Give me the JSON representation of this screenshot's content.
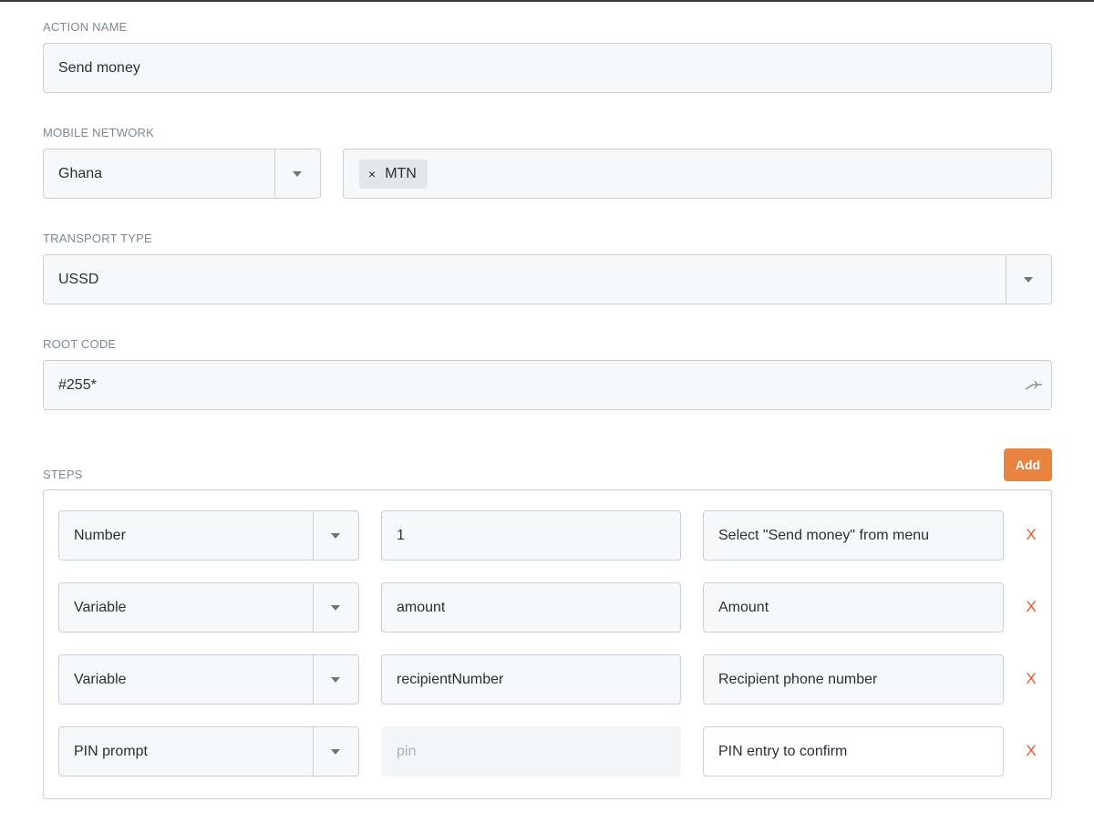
{
  "action_name": {
    "label": "ACTION NAME",
    "value": "Send money"
  },
  "mobile_network": {
    "label": "MOBILE NETWORK",
    "country": "Ghana",
    "tags": [
      {
        "remove": "×",
        "text": "MTN"
      }
    ]
  },
  "transport_type": {
    "label": "TRANSPORT TYPE",
    "value": "USSD"
  },
  "root_code": {
    "label": "ROOT CODE",
    "value": "#255*"
  },
  "steps": {
    "label": "STEPS",
    "add_label": "Add",
    "remove_label": "X",
    "rows": [
      {
        "type": "Number",
        "value": "1",
        "placeholder": "",
        "description": "Select \"Send money\" from menu"
      },
      {
        "type": "Variable",
        "value": "amount",
        "placeholder": "",
        "description": "Amount"
      },
      {
        "type": "Variable",
        "value": "recipientNumber",
        "placeholder": "",
        "description": "Recipient phone number"
      },
      {
        "type": "PIN prompt",
        "value": "",
        "placeholder": "pin",
        "description": "PIN entry to confirm"
      }
    ]
  },
  "colors": {
    "accent": "#e8843f",
    "remove": "#e05a2b",
    "label": "#7b8a99"
  },
  "icons": {
    "caret": "chevron-down-icon",
    "tag_remove": "close-icon",
    "root_code_action": "key-icon"
  }
}
